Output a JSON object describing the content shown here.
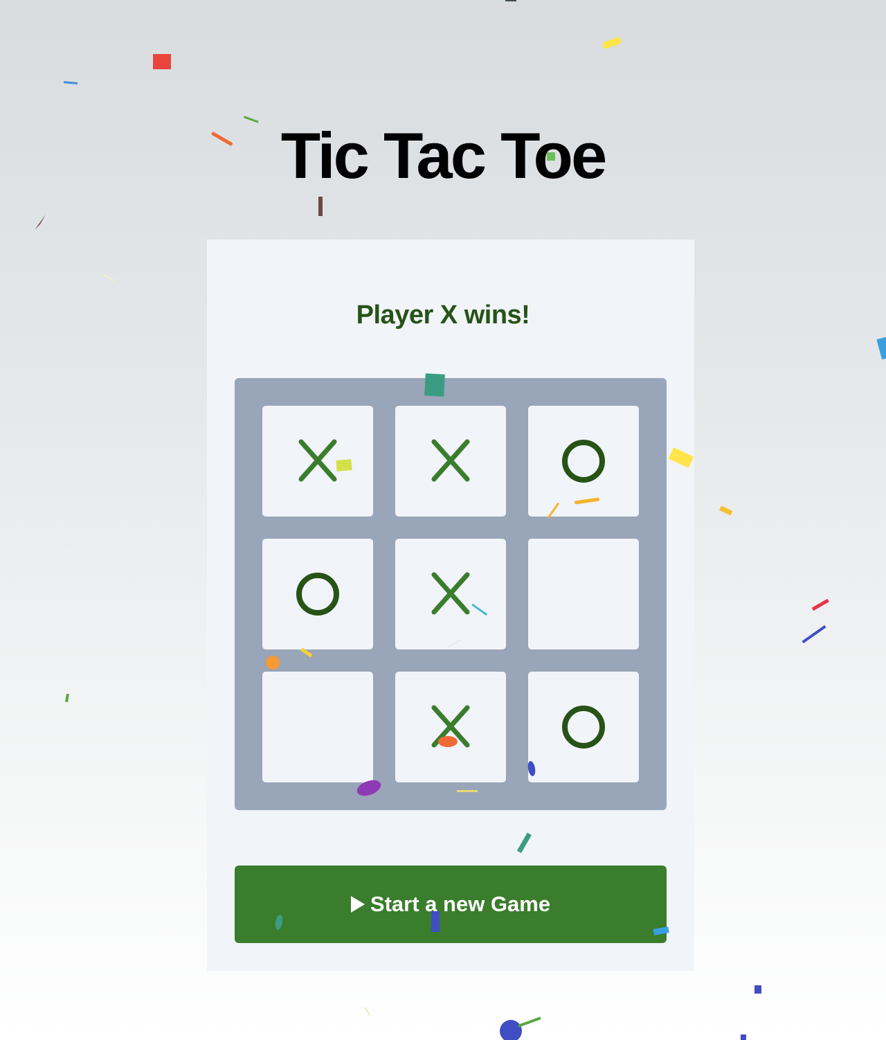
{
  "title": "Tic Tac Toe",
  "status": "Player X wins!",
  "board": [
    "X",
    "X",
    "O",
    "O",
    "X",
    "",
    "",
    "X",
    "O"
  ],
  "new_game_label": "Start a new Game",
  "colors": {
    "x_mark": "#3a7d2c",
    "o_mark": "#275317",
    "button": "#3a7d2c",
    "board": "#99a5b8",
    "cell": "#f1f4f9"
  },
  "icons": {
    "button_icon": "play-icon"
  }
}
